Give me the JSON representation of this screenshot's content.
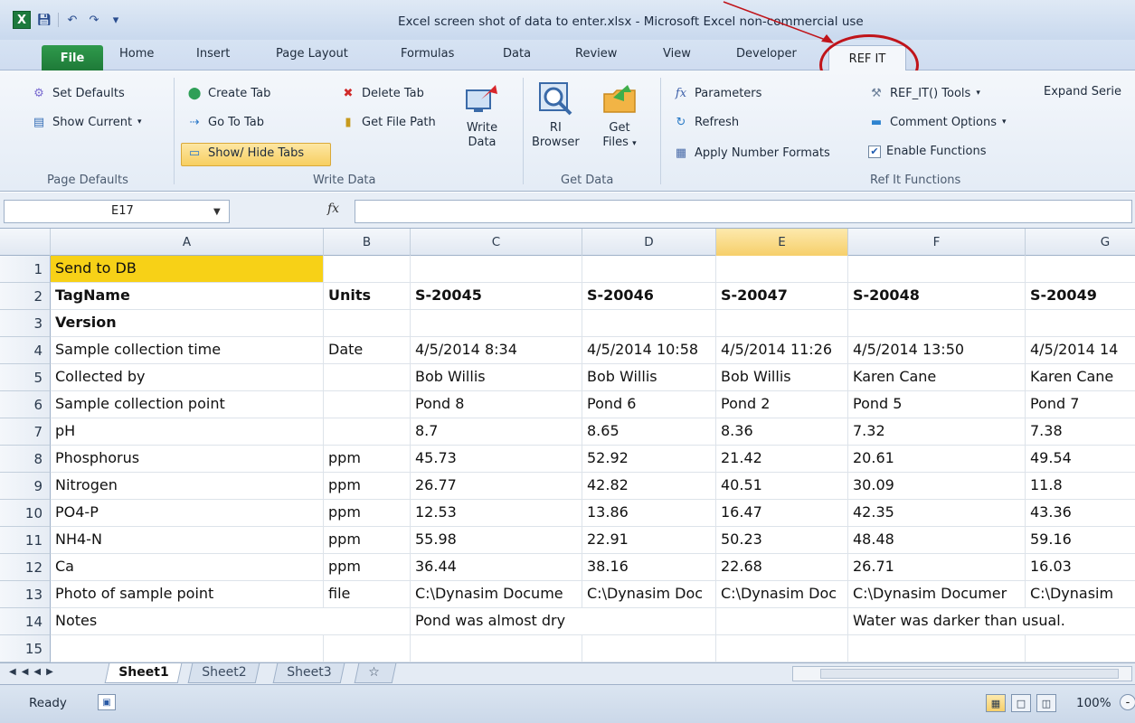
{
  "window": {
    "title": "Excel screen shot of data to enter.xlsx  -  Microsoft Excel non-commercial use",
    "app_icon": "X"
  },
  "tabs": {
    "file": "File",
    "items": [
      "Home",
      "Insert",
      "Page Layout",
      "Formulas",
      "Data",
      "Review",
      "View",
      "Developer"
    ],
    "active": "REF IT"
  },
  "ribbon": {
    "page_defaults": {
      "set_defaults": "Set Defaults",
      "show_current": "Show Current",
      "label": "Page Defaults"
    },
    "write_data": {
      "create_tab": "Create Tab",
      "go_to_tab": "Go To Tab",
      "show_hide_tabs": "Show/ Hide Tabs",
      "delete_tab": "Delete Tab",
      "get_file_path": "Get File Path",
      "write_data_line1": "Write",
      "write_data_line2": "Data",
      "label": "Write Data"
    },
    "get_data": {
      "ri_browser_line1": "RI",
      "ri_browser_line2": "Browser",
      "get_files_line1": "Get",
      "get_files_line2": "Files",
      "label": "Get Data"
    },
    "ref_it_functions": {
      "parameters": "Parameters",
      "refresh": "Refresh",
      "apply_number_formats": "Apply Number Formats",
      "ref_it_tools": "REF_IT() Tools",
      "comment_options": "Comment Options",
      "enable_functions": "Enable Functions",
      "label": "Ref It Functions"
    },
    "expand_series": "Expand Serie"
  },
  "formula_bar": {
    "name_box": "E17",
    "fx": "fx",
    "value": ""
  },
  "grid": {
    "columns": [
      "A",
      "B",
      "C",
      "D",
      "E",
      "F",
      "G"
    ],
    "selected_column": "E",
    "rows": [
      {
        "num": "1",
        "cells": [
          "Send to DB",
          "",
          "",
          "",
          "",
          "",
          ""
        ]
      },
      {
        "num": "2",
        "cells": [
          "TagName",
          "Units",
          "S-20045",
          "S-20046",
          "S-20047",
          "S-20048",
          "S-20049"
        ]
      },
      {
        "num": "3",
        "cells": [
          "Version",
          "",
          "",
          "",
          "",
          "",
          ""
        ]
      },
      {
        "num": "4",
        "cells": [
          "Sample collection time",
          "Date",
          "4/5/2014 8:34",
          "4/5/2014 10:58",
          "4/5/2014 11:26",
          "4/5/2014 13:50",
          "4/5/2014 14"
        ]
      },
      {
        "num": "5",
        "cells": [
          "Collected by",
          "",
          "Bob Willis",
          "Bob Willis",
          "Bob Willis",
          "Karen Cane",
          "Karen Cane"
        ]
      },
      {
        "num": "6",
        "cells": [
          "Sample collection point",
          "",
          "Pond 8",
          "Pond 6",
          "Pond 2",
          "Pond 5",
          "Pond 7"
        ]
      },
      {
        "num": "7",
        "cells": [
          "pH",
          "",
          "8.7",
          "8.65",
          "8.36",
          "7.32",
          "7.38"
        ]
      },
      {
        "num": "8",
        "cells": [
          "Phosphorus",
          "ppm",
          "45.73",
          "52.92",
          "21.42",
          "20.61",
          "49.54"
        ]
      },
      {
        "num": "9",
        "cells": [
          "Nitrogen",
          "ppm",
          "26.77",
          "42.82",
          "40.51",
          "30.09",
          "11.8"
        ]
      },
      {
        "num": "10",
        "cells": [
          "PO4-P",
          "ppm",
          "12.53",
          "13.86",
          "16.47",
          "42.35",
          "43.36"
        ]
      },
      {
        "num": "11",
        "cells": [
          "NH4-N",
          "ppm",
          "55.98",
          "22.91",
          "50.23",
          "48.48",
          "59.16"
        ]
      },
      {
        "num": "12",
        "cells": [
          "Ca",
          "ppm",
          "36.44",
          "38.16",
          "22.68",
          "26.71",
          "16.03"
        ]
      },
      {
        "num": "13",
        "cells": [
          "Photo of sample point",
          "file",
          "C:\\Dynasim Docume",
          "C:\\Dynasim Doc",
          "C:\\Dynasim Doc",
          "C:\\Dynasim Documer",
          "C:\\Dynasim"
        ]
      },
      {
        "num": "14",
        "cells": [
          "Notes",
          "",
          "Pond was almost dry",
          "",
          "",
          "Water was darker than usual.",
          ""
        ]
      },
      {
        "num": "15",
        "cells": [
          "",
          "",
          "",
          "",
          "",
          "",
          ""
        ]
      }
    ]
  },
  "sheets": {
    "tabs": [
      "Sheet1",
      "Sheet2",
      "Sheet3"
    ],
    "active": "Sheet1"
  },
  "status": {
    "ready": "Ready",
    "zoom": "100%",
    "zoom_minus": "-"
  },
  "colors": {
    "gold_cell": "#f7d117",
    "file_tab": "#1e7a38",
    "highlight_ring": "#c0141a"
  }
}
